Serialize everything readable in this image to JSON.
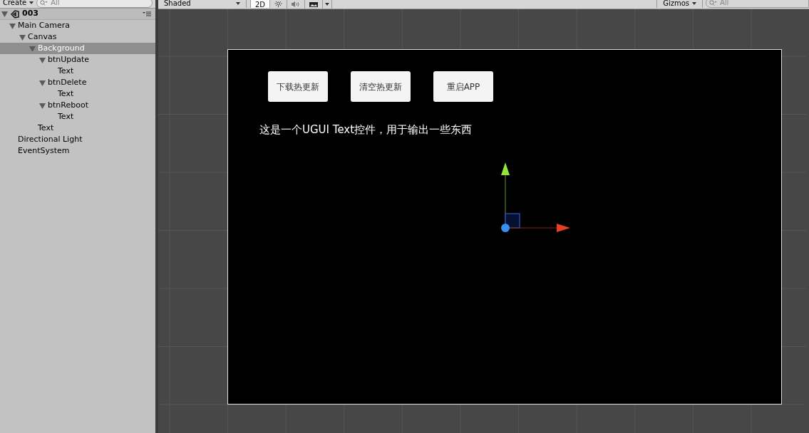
{
  "hierarchy": {
    "create_button": "Create",
    "search": {
      "placeholder": "All"
    },
    "scene": {
      "name": "003",
      "expanded": true
    },
    "items": [
      {
        "label": "Main Camera",
        "expanded": true,
        "selected": false,
        "children": [
          {
            "label": "Canvas",
            "expanded": true,
            "selected": false,
            "children": [
              {
                "label": "Background",
                "expanded": true,
                "selected": true,
                "children": [
                  {
                    "label": "btnUpdate",
                    "expanded": true,
                    "selected": false,
                    "children": [
                      {
                        "label": "Text",
                        "selected": false
                      }
                    ]
                  },
                  {
                    "label": "btnDelete",
                    "expanded": true,
                    "selected": false,
                    "children": [
                      {
                        "label": "Text",
                        "selected": false
                      }
                    ]
                  },
                  {
                    "label": "btnReboot",
                    "expanded": true,
                    "selected": false,
                    "children": [
                      {
                        "label": "Text",
                        "selected": false
                      }
                    ]
                  }
                ]
              },
              {
                "label": "Text",
                "selected": false
              }
            ]
          }
        ]
      },
      {
        "label": "Directional Light",
        "selected": false
      },
      {
        "label": "EventSystem",
        "selected": false
      }
    ]
  },
  "scene_toolbar": {
    "shading": "Shaded",
    "mode_2d": {
      "label": "2D",
      "selected": true
    },
    "gizmos": "Gizmos",
    "search": {
      "placeholder": "All"
    }
  },
  "game_canvas": {
    "buttons": [
      "下载热更新",
      "清空热更新",
      "重启APP"
    ],
    "text": "这是一个UGUI Text控件，用于输出一些东西"
  }
}
